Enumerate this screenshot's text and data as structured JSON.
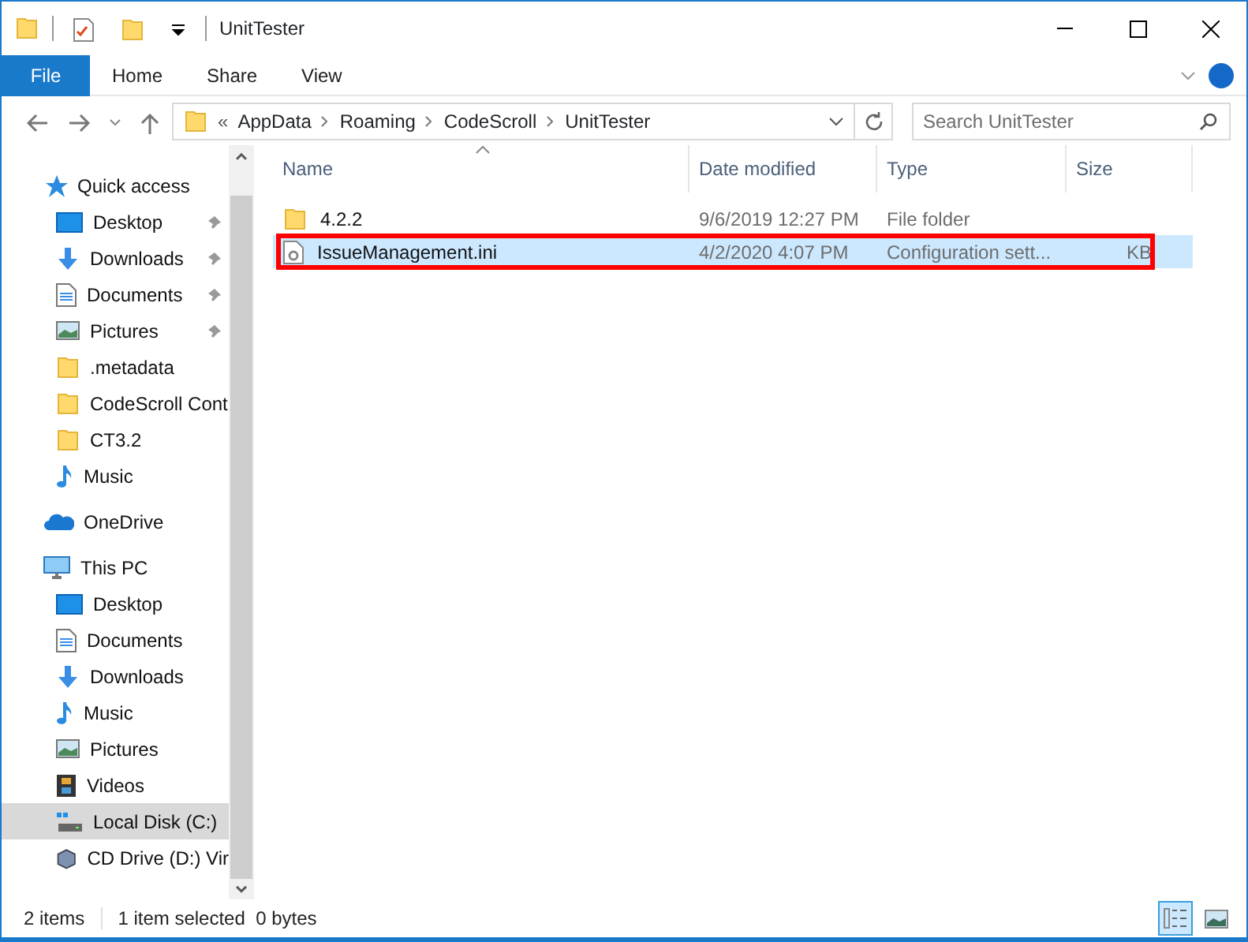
{
  "window": {
    "title": "UnitTester"
  },
  "ribbon_tabs": [
    {
      "label": "File",
      "selected": true
    },
    {
      "label": "Home",
      "selected": false
    },
    {
      "label": "Share",
      "selected": false
    },
    {
      "label": "View",
      "selected": false
    }
  ],
  "address": {
    "overflow": "«",
    "crumbs": [
      "AppData",
      "Roaming",
      "CodeScroll",
      "UnitTester"
    ]
  },
  "search": {
    "placeholder": "Search UnitTester"
  },
  "sidebar": {
    "items": [
      {
        "label": "Quick access",
        "kind": "star",
        "selected": false,
        "children": [
          {
            "label": "Desktop",
            "kind": "desktop",
            "pinned": true,
            "selected": false
          },
          {
            "label": "Downloads",
            "kind": "downloads",
            "pinned": true,
            "selected": false
          },
          {
            "label": "Documents",
            "kind": "documents",
            "pinned": true,
            "selected": false
          },
          {
            "label": "Pictures",
            "kind": "pictures",
            "pinned": true,
            "selected": false
          },
          {
            "label": ".metadata",
            "kind": "folder",
            "pinned": false,
            "selected": false
          },
          {
            "label": "CodeScroll Cont",
            "kind": "folder",
            "pinned": false,
            "selected": false
          },
          {
            "label": "CT3.2",
            "kind": "folder",
            "pinned": false,
            "selected": false
          },
          {
            "label": "Music",
            "kind": "music",
            "pinned": false,
            "selected": false
          }
        ]
      },
      {
        "label": "OneDrive",
        "kind": "cloud",
        "selected": false
      },
      {
        "label": "This PC",
        "kind": "pc",
        "selected": false,
        "children": [
          {
            "label": "Desktop",
            "kind": "desktop",
            "selected": false
          },
          {
            "label": "Documents",
            "kind": "documents",
            "selected": false
          },
          {
            "label": "Downloads",
            "kind": "downloads",
            "selected": false
          },
          {
            "label": "Music",
            "kind": "music",
            "selected": false
          },
          {
            "label": "Pictures",
            "kind": "pictures",
            "selected": false
          },
          {
            "label": "Videos",
            "kind": "videos",
            "selected": false
          },
          {
            "label": "Local Disk (C:)",
            "kind": "drive",
            "selected": true
          },
          {
            "label": "CD Drive (D:) Vir",
            "kind": "cd",
            "selected": false
          }
        ]
      }
    ]
  },
  "table": {
    "columns": [
      "Name",
      "Date modified",
      "Type",
      "Size"
    ],
    "rows": [
      {
        "name": "4.2.2",
        "date": "9/6/2019 12:27 PM",
        "type": "File folder",
        "size": "",
        "kind": "folder",
        "selected": false,
        "highlighted": false
      },
      {
        "name": "IssueManagement.ini",
        "date": "4/2/2020 4:07 PM",
        "type": "Configuration sett...",
        "size": "KB",
        "kind": "config",
        "selected": true,
        "highlighted": true
      }
    ]
  },
  "status_bar": {
    "count": "2 items",
    "selection": "1 item selected  0 bytes",
    "views": [
      {
        "kind": "details",
        "selected": true
      },
      {
        "kind": "large",
        "selected": false
      }
    ]
  }
}
